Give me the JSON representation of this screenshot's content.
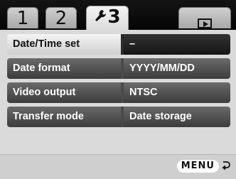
{
  "tabs": [
    {
      "label": "1"
    },
    {
      "label": "2"
    },
    {
      "label": "3"
    },
    {
      "label": ""
    }
  ],
  "menu": {
    "rows": [
      {
        "label": "Date/Time set",
        "value": "–"
      },
      {
        "label": "Date format",
        "value": "YYYY/MM/DD"
      },
      {
        "label": "Video output",
        "value": "NTSC"
      },
      {
        "label": "Transfer mode",
        "value": "Date storage"
      }
    ]
  },
  "footer": {
    "menu_label": "MENU"
  },
  "icons": {
    "wrench": "wrench-icon",
    "play": "playback-icon",
    "return": "return-icon"
  }
}
